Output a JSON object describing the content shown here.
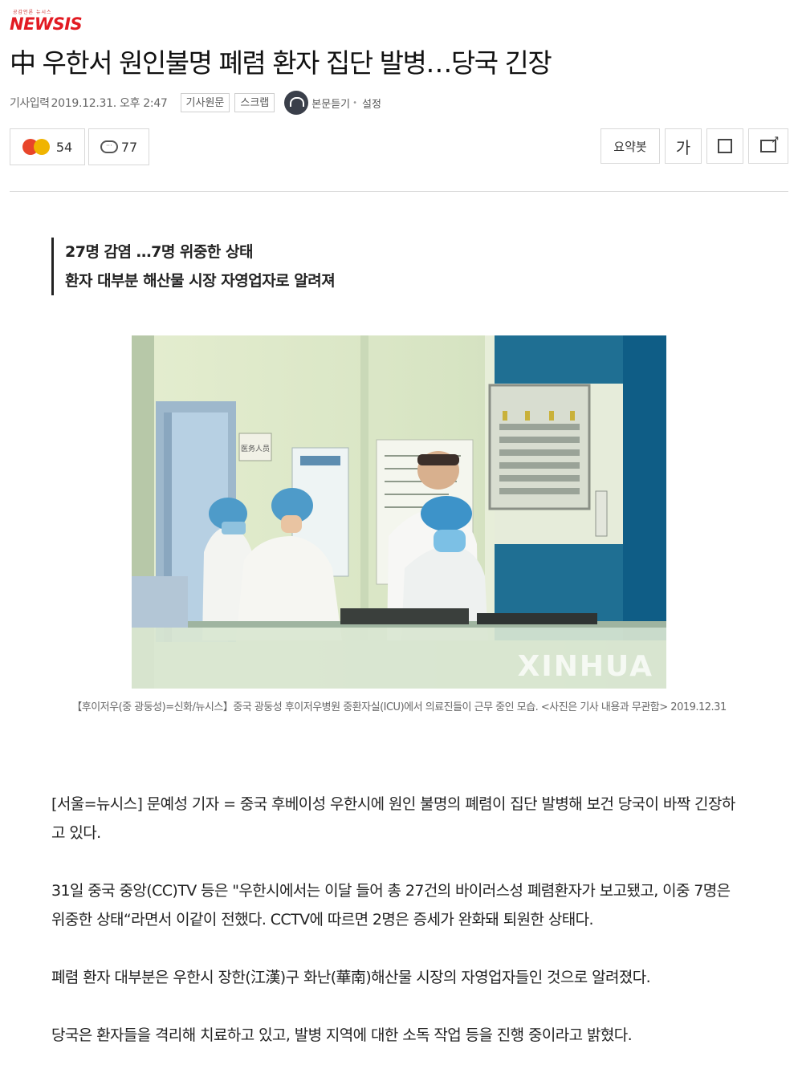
{
  "brand": {
    "tagline": "공감언론 뉴시스",
    "logo_text": "NEWSIS",
    "color": "#e21b23"
  },
  "article": {
    "title": "中 우한서 원인불명 폐렴 환자 집단 발병…당국 긴장",
    "date_label": "기사입력",
    "date": "2019.12.31. 오후 2:47",
    "subtitle_lines": [
      "27명 감염 …7명 위중한 상태",
      "환자 대부분 해산물 시장 자영업자로 알려져"
    ],
    "photo": {
      "watermark": "XINHUA",
      "sign_text": "医务人员"
    },
    "caption": "【후이저우(중 광둥성)=신화/뉴시스】중국 광둥성 후이저우병원 중환자실(ICU)에서 의료진들이 근무 중인 모습. <사진은 기사 내용과 무관함> 2019.12.31",
    "paragraphs": [
      "[서울=뉴시스] 문예성 기자 = 중국 후베이성 우한시에 원인 불명의 폐렴이 집단 발병해 보건 당국이 바짝 긴장하고 있다.",
      "31일 중국 중앙(CC)TV 등은 \"우한시에서는 이달 들어 총 27건의 바이러스성 폐렴환자가 보고됐고, 이중 7명은 위중한 상태“라면서 이같이 전했다. CCTV에 따르면 2명은 증세가 완화돼 퇴원한 상태다.",
      "폐렴 환자 대부분은 우한시 장한(江漢)구 화난(華南)해산물 시장의 자영업자들인 것으로 알려졌다.",
      "당국은 환자들을 격리해 치료하고 있고, 발병 지역에 대한 소독 작업 등을 진행 중이라고 밝혔다."
    ]
  },
  "meta_buttons": {
    "original": "기사원문",
    "scrap": "스크랩",
    "listen": "본문듣기",
    "settings": "설정"
  },
  "actions": {
    "reaction_count": "54",
    "comment_count": "77",
    "summary_label": "요약봇",
    "font_label": "가"
  },
  "icons": [
    "angry-emoji-icon",
    "sad-emoji-icon",
    "comment-icon",
    "speaker-icon",
    "print-icon",
    "share-icon"
  ]
}
